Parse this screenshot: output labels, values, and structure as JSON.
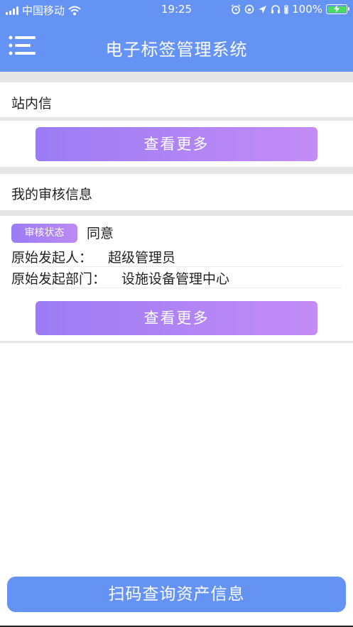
{
  "status_bar": {
    "carrier": "中国移动",
    "time": "19:25",
    "battery_text": "100%"
  },
  "header": {
    "title": "电子标签管理系统",
    "menu_icon": "menu-icon"
  },
  "messages": {
    "title": "站内信",
    "more_label": "查看更多"
  },
  "audit": {
    "title": "我的审核信息",
    "status_badge": "审核状态",
    "status_value": "同意",
    "initiator_label": "原始发起人：",
    "initiator_value": "超级管理员",
    "department_label": "原始发起部门：",
    "department_value": "设施设备管理中心",
    "more_label": "查看更多"
  },
  "footer": {
    "scan_label": "扫码查询资产信息"
  },
  "colors": {
    "primary": "#6493f3",
    "gradient_start": "#9b7cf3",
    "gradient_end": "#c48cf6",
    "battery": "#4cd964"
  }
}
